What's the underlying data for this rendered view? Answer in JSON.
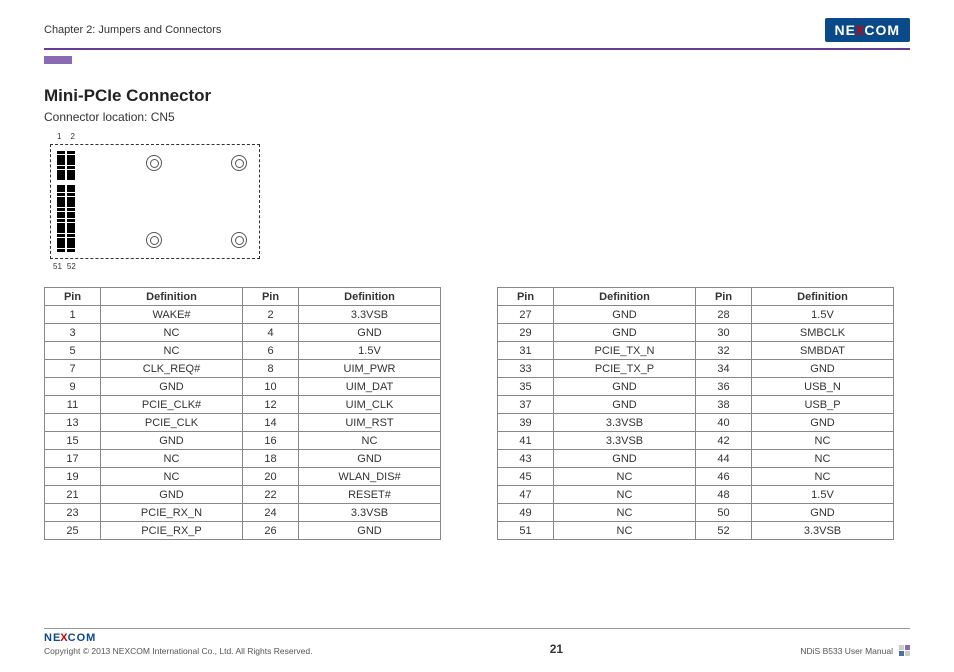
{
  "header": {
    "chapter": "Chapter 2: Jumpers and Connectors",
    "brand": "NEXCOM"
  },
  "section": {
    "title": "Mini-PCIe Connector",
    "subtitle": "Connector location: CN5"
  },
  "diagram": {
    "top_pin_labels": [
      "1",
      "2"
    ],
    "bottom_pin_labels": [
      "51",
      "52"
    ]
  },
  "table1": {
    "headers": [
      "Pin",
      "Definition",
      "Pin",
      "Definition"
    ],
    "rows": [
      [
        "1",
        "WAKE#",
        "2",
        "3.3VSB"
      ],
      [
        "3",
        "NC",
        "4",
        "GND"
      ],
      [
        "5",
        "NC",
        "6",
        "1.5V"
      ],
      [
        "7",
        "CLK_REQ#",
        "8",
        "UIM_PWR"
      ],
      [
        "9",
        "GND",
        "10",
        "UIM_DAT"
      ],
      [
        "11",
        "PCIE_CLK#",
        "12",
        "UIM_CLK"
      ],
      [
        "13",
        "PCIE_CLK",
        "14",
        "UIM_RST"
      ],
      [
        "15",
        "GND",
        "16",
        "NC"
      ],
      [
        "17",
        "NC",
        "18",
        "GND"
      ],
      [
        "19",
        "NC",
        "20",
        "WLAN_DIS#"
      ],
      [
        "21",
        "GND",
        "22",
        "RESET#"
      ],
      [
        "23",
        "PCIE_RX_N",
        "24",
        "3.3VSB"
      ],
      [
        "25",
        "PCIE_RX_P",
        "26",
        "GND"
      ]
    ]
  },
  "table2": {
    "headers": [
      "Pin",
      "Definition",
      "Pin",
      "Definition"
    ],
    "rows": [
      [
        "27",
        "GND",
        "28",
        "1.5V"
      ],
      [
        "29",
        "GND",
        "30",
        "SMBCLK"
      ],
      [
        "31",
        "PCIE_TX_N",
        "32",
        "SMBDAT"
      ],
      [
        "33",
        "PCIE_TX_P",
        "34",
        "GND"
      ],
      [
        "35",
        "GND",
        "36",
        "USB_N"
      ],
      [
        "37",
        "GND",
        "38",
        "USB_P"
      ],
      [
        "39",
        "3.3VSB",
        "40",
        "GND"
      ],
      [
        "41",
        "3.3VSB",
        "42",
        "NC"
      ],
      [
        "43",
        "GND",
        "44",
        "NC"
      ],
      [
        "45",
        "NC",
        "46",
        "NC"
      ],
      [
        "47",
        "NC",
        "48",
        "1.5V"
      ],
      [
        "49",
        "NC",
        "50",
        "GND"
      ],
      [
        "51",
        "NC",
        "52",
        "3.3VSB"
      ]
    ]
  },
  "footer": {
    "copyright": "Copyright © 2013 NEXCOM International Co., Ltd. All Rights Reserved.",
    "page": "21",
    "doc": "NDiS B533 User Manual"
  }
}
